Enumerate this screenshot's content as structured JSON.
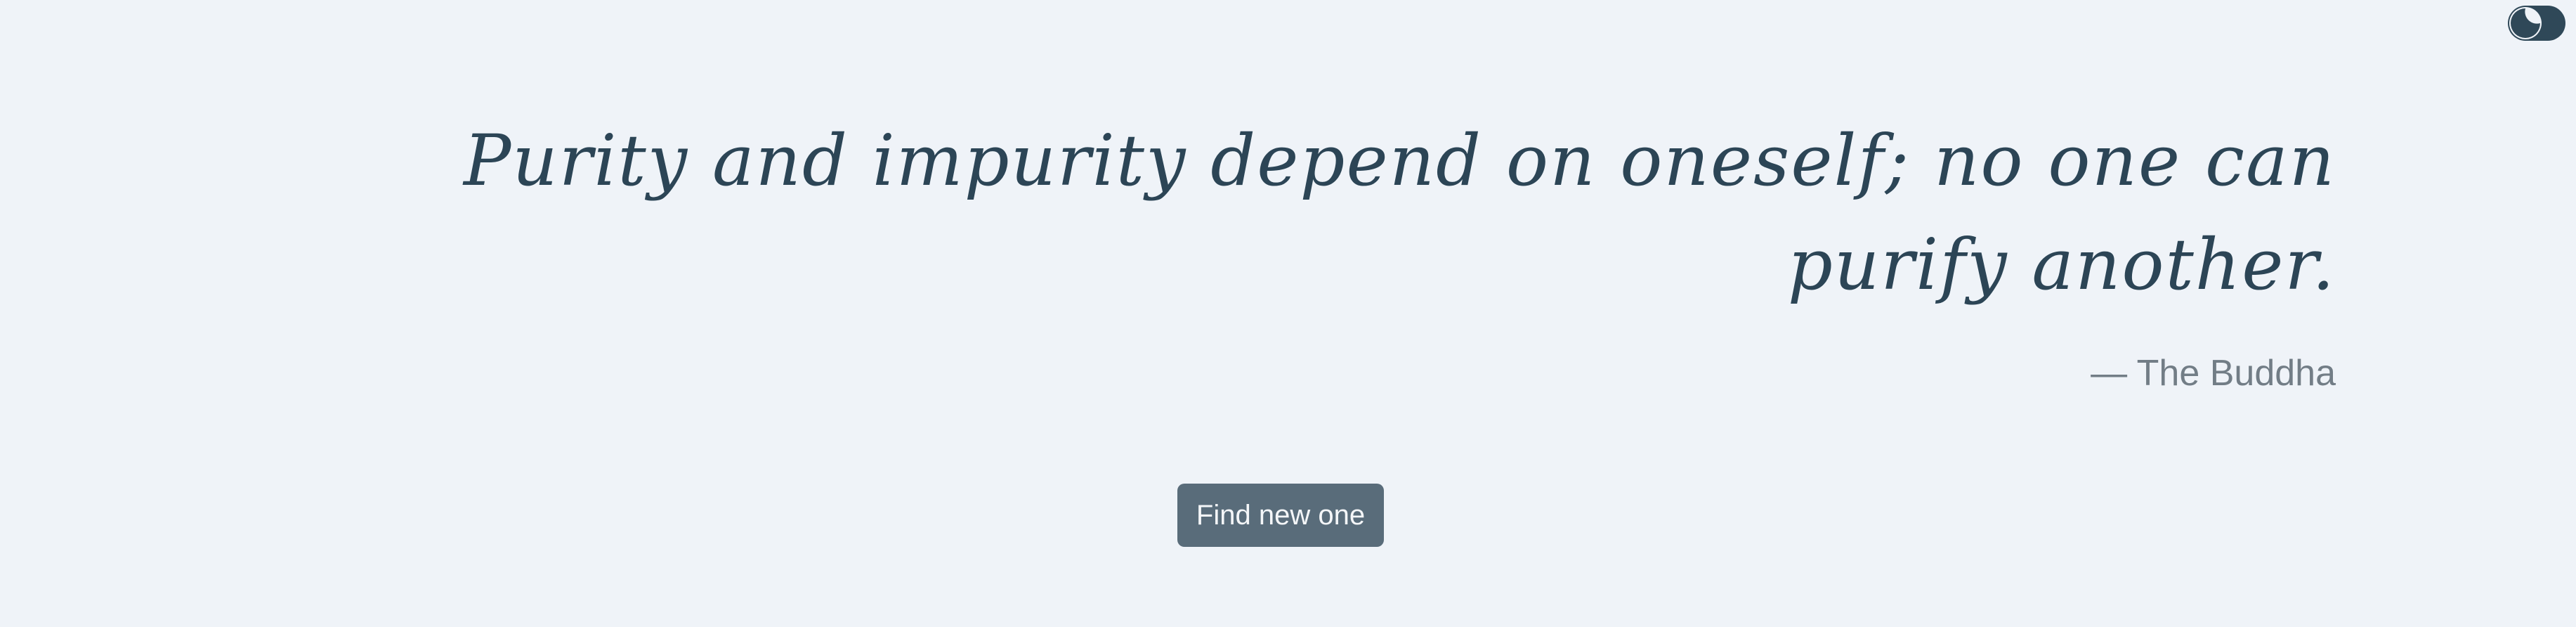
{
  "quote": {
    "text": "Purity and impurity depend on oneself; no one can purify another.",
    "author": "— The Buddha"
  },
  "actions": {
    "new_quote_label": "Find new one"
  },
  "theme_toggle": {
    "icon": "moon-icon",
    "mode": "dark-mode-toggle"
  },
  "colors": {
    "background": "#eff3f8",
    "quote_text": "#2c4556",
    "author_text": "#727d86",
    "button_bg": "#596c7a",
    "toggle_bg": "#2f4858"
  }
}
